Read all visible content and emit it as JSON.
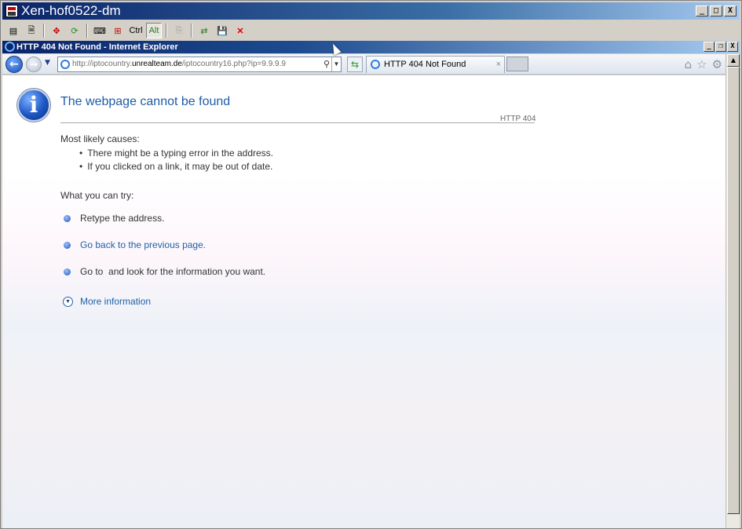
{
  "outer_window": {
    "title": "Xen-hof0522-dm",
    "toolbar": {
      "ctrl_label": "Ctrl",
      "alt_label": "Alt"
    },
    "window_buttons": [
      "_",
      "□",
      "X"
    ]
  },
  "ie_window": {
    "title": "HTTP 404 Not Found - Internet Explorer",
    "window_buttons": [
      "_",
      "❐",
      "X"
    ]
  },
  "navbar": {
    "address_prefix": "http://iptocountry.",
    "address_domain": "unrealteam.de",
    "address_suffix": "/iptocountry16.php?ip=9.9.9.9",
    "tab_title": "HTTP 404 Not Found",
    "tab_close": "×"
  },
  "page": {
    "title": "The webpage cannot be found",
    "error_code": "HTTP 404",
    "causes_heading": "Most likely causes:",
    "causes": [
      "There might be a typing error in the address.",
      "If you clicked on a link, it may be out of date."
    ],
    "try_heading": "What you can try:",
    "try_items": [
      {
        "text": "Retype the address."
      },
      {
        "text": "Go back to the previous page."
      },
      {
        "text": "Go to  and look for the information you want."
      }
    ],
    "more_info": "More information"
  }
}
